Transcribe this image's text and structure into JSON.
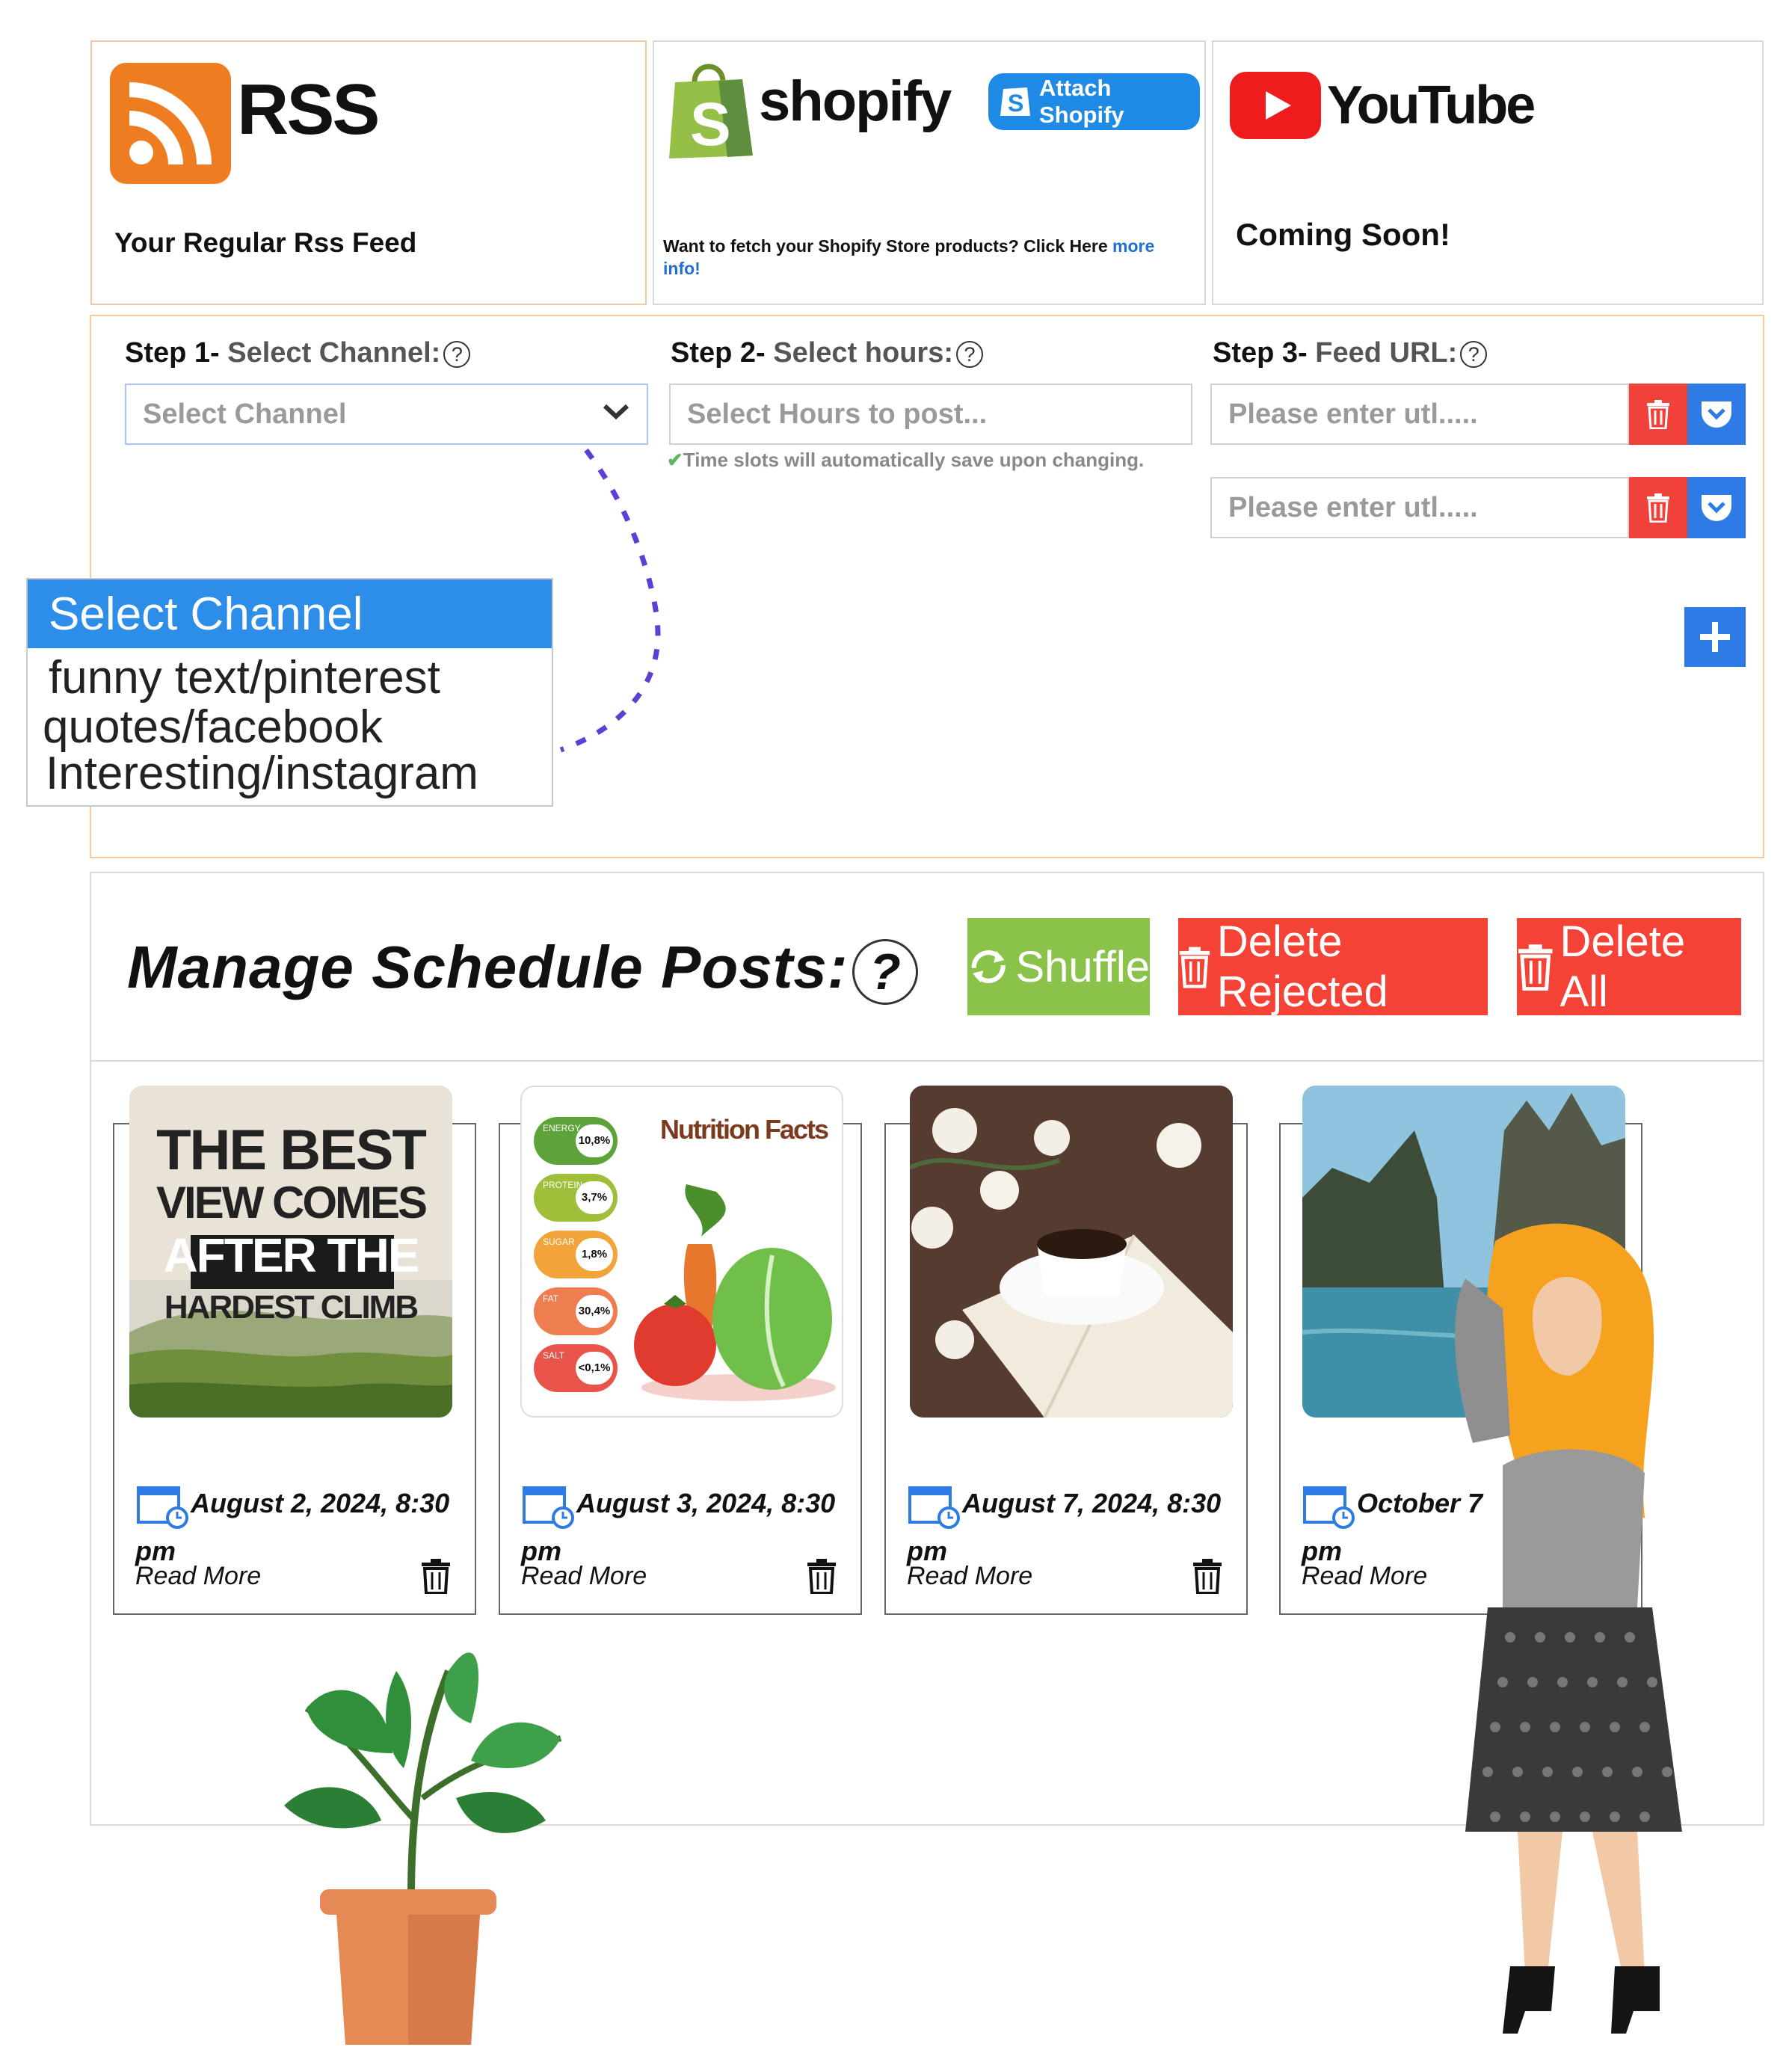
{
  "sources": {
    "rss": {
      "title": "RSS",
      "description": "Your Regular Rss Feed"
    },
    "shopify": {
      "brand": "shopify",
      "attach_label": "Attach Shopify",
      "description": "Want to fetch your Shopify Store products? Click Here",
      "link_text": "more info!"
    },
    "youtube": {
      "brand": "YouTube",
      "description": "Coming Soon!"
    }
  },
  "steps": {
    "step1": {
      "prefix": "Step 1-",
      "label": "Select Channel:",
      "help": "?"
    },
    "step2": {
      "prefix": "Step 2-",
      "label": "Select hours:",
      "help": "?"
    },
    "step3": {
      "prefix": "Step 3-",
      "label": "Feed URL:",
      "help": "?"
    },
    "channel_select": {
      "value": "Select Channel"
    },
    "hours_select": {
      "placeholder": "Select Hours to post..."
    },
    "hint": "Time slots will automatically save upon changing.",
    "feed_urls": [
      {
        "placeholder": "Please enter utl....."
      },
      {
        "placeholder": "Please enter utl....."
      }
    ]
  },
  "dropdown": {
    "selected": "Select Channel",
    "options": [
      "funny text/pinterest",
      "quotes/facebook",
      "Interesting/instagram"
    ]
  },
  "manage": {
    "title": "Manage Schedule Posts:",
    "help": "?",
    "shuffle_label": "Shuffle",
    "delete_rejected_label": "Delete Rejected",
    "delete_all_label": "Delete All"
  },
  "posts": [
    {
      "date": "August 2, 2024, 8:30",
      "time_suffix": "pm",
      "read_more": "Read More",
      "image_text": [
        "THE BEST",
        "VIEW COMES",
        "AFTER THE",
        "HARDEST CLIMB"
      ]
    },
    {
      "date": "August 3, 2024, 8:30",
      "time_suffix": "pm",
      "read_more": "Read More",
      "image_text": {
        "title": "Nutrition Facts",
        "rows": [
          {
            "name": "ENERGY",
            "pct": "10,8%",
            "color": "#5ea23a"
          },
          {
            "name": "PROTEIN",
            "pct": "3,7%",
            "color": "#9fbf3a"
          },
          {
            "name": "SUGAR",
            "pct": "1,8%",
            "color": "#f2a33a"
          },
          {
            "name": "FAT",
            "pct": "30,4%",
            "color": "#ee7d50"
          },
          {
            "name": "SALT",
            "pct": "<0,1%",
            "color": "#e8534a"
          }
        ]
      }
    },
    {
      "date": "August 7, 2024, 8:30",
      "time_suffix": "pm",
      "read_more": "Read More"
    },
    {
      "date": "October 7",
      "time_suffix": "pm",
      "read_more": "Read More"
    }
  ],
  "colors": {
    "accent_blue": "#2e7be6",
    "danger": "#f44336",
    "success": "#8bc34a",
    "rss_orange": "#ee7d21",
    "youtube_red": "#ee1c1c"
  }
}
